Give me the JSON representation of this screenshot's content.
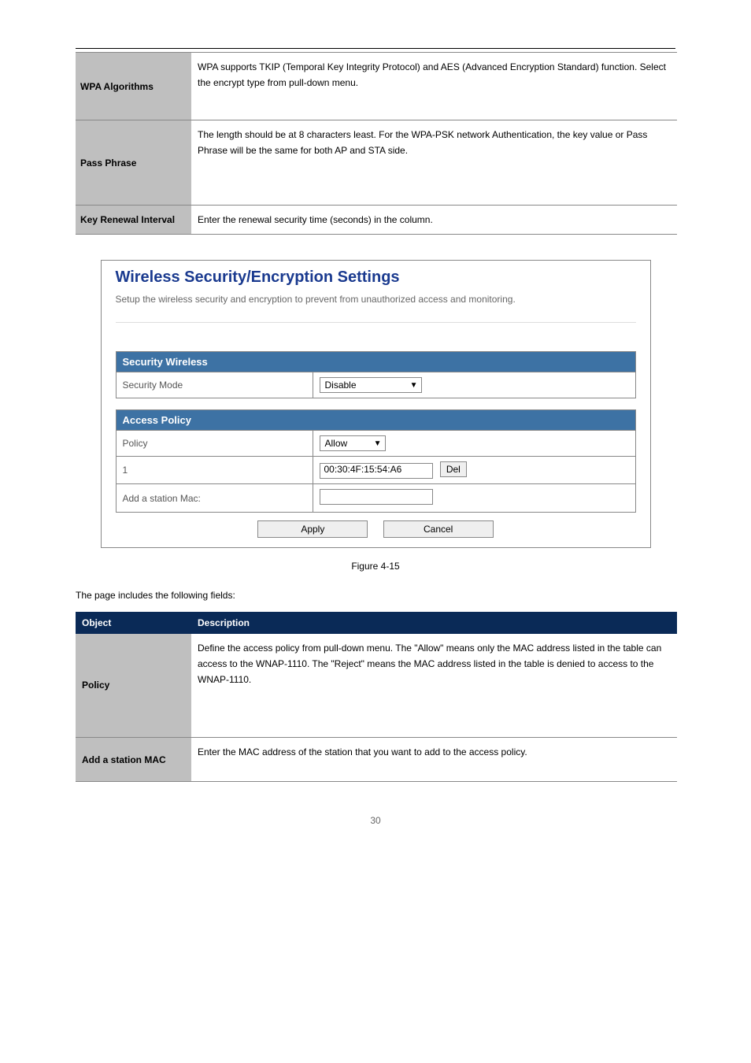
{
  "top_table": {
    "rows": [
      {
        "label": "WPA Algorithms",
        "text": "WPA supports TKIP (Temporal Key Integrity Protocol) and AES (Advanced Encryption Standard) function. Select the encrypt type from pull-down menu."
      },
      {
        "label": "Pass Phrase",
        "text": "The length should be at 8 characters least. For the WPA-PSK network Authentication, the key value or Pass Phrase will be the same for both AP and STA side."
      },
      {
        "label": "Key Renewal Interval",
        "text": "Enter the renewal security time (seconds) in the column."
      }
    ]
  },
  "panel": {
    "title": "Wireless Security/Encryption Settings",
    "subtitle": "Setup the wireless security and encryption to prevent from unauthorized access and monitoring.",
    "section_security": "Security Wireless",
    "security_mode_label": "Security Mode",
    "security_mode_value": "Disable",
    "section_access": "Access Policy",
    "policy_label": "Policy",
    "policy_value": "Allow",
    "row_index": "1",
    "mac_value": "00:30:4F:15:54:A6",
    "del_label": "Del",
    "add_label": "Add a station Mac:",
    "add_value": "",
    "apply_label": "Apply",
    "cancel_label": "Cancel"
  },
  "figure_caption": "Figure 4-15",
  "intro_after": "The page includes the following fields:",
  "obj_table": {
    "header": [
      "Object",
      "Description"
    ],
    "rows": [
      {
        "label": "Policy",
        "text": "Define the access policy from pull-down menu. The \"Allow\" means only the MAC address listed in the table can access to the WNAP-1110. The \"Reject\" means the MAC address listed in the table is denied to access to the WNAP-1110."
      },
      {
        "label": "Add a station MAC",
        "text": "Enter the MAC address of the station that you want to add to the access policy."
      }
    ]
  },
  "page_number": "30"
}
